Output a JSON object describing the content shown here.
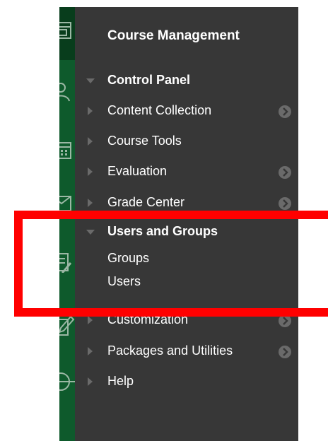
{
  "panel": {
    "title": "Course Management",
    "items": [
      {
        "label": "Control Panel",
        "state": "expanded",
        "bold": true,
        "arrow": false
      },
      {
        "label": "Content Collection",
        "state": "collapsed",
        "bold": false,
        "arrow": true
      },
      {
        "label": "Course Tools",
        "state": "collapsed",
        "bold": false,
        "arrow": false
      },
      {
        "label": "Evaluation",
        "state": "collapsed",
        "bold": false,
        "arrow": true
      },
      {
        "label": "Grade Center",
        "state": "collapsed",
        "bold": false,
        "arrow": true
      },
      {
        "label": "Users and Groups",
        "state": "expanded",
        "bold": true,
        "arrow": false
      },
      {
        "label": "Customization",
        "state": "collapsed",
        "bold": false,
        "arrow": true
      },
      {
        "label": "Packages and Utilities",
        "state": "collapsed",
        "bold": false,
        "arrow": true
      },
      {
        "label": "Help",
        "state": "collapsed",
        "bold": false,
        "arrow": false
      }
    ],
    "users_and_groups_children": [
      "Groups",
      "Users"
    ]
  },
  "colors": {
    "rail": "#0e5a2c",
    "panel": "#373737",
    "highlight": "#ff0000"
  }
}
